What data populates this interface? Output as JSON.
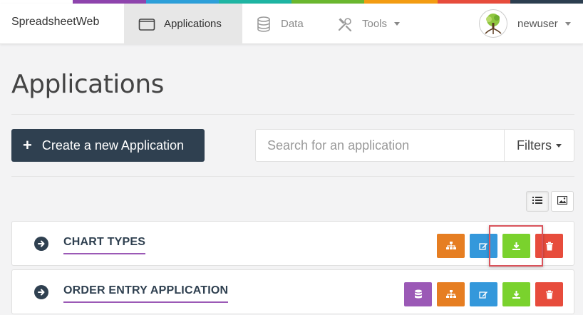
{
  "colors": {
    "strip": [
      "#ffffff",
      "#ffffff",
      "#8e44ad",
      "#3498db",
      "#1abc9c",
      "#7ac142",
      "#f39c12",
      "#e74c3c",
      "#2c3e50"
    ],
    "dark": "#2f4050",
    "purple": "#9b59b6",
    "orange": "#e67e22",
    "blue": "#3498db",
    "green": "#7ad22d",
    "red": "#e74c3c"
  },
  "navbar": {
    "brand": "SpreadsheetWeb",
    "items": [
      {
        "label": "Applications",
        "icon": "window-icon",
        "active": true
      },
      {
        "label": "Data",
        "icon": "database-icon",
        "active": false
      },
      {
        "label": "Tools",
        "icon": "tools-icon",
        "active": false
      }
    ],
    "user": {
      "name": "newuser",
      "avatar_icon": "tree-avatar-icon"
    }
  },
  "page": {
    "title": "Applications",
    "create_label": "Create a new Application",
    "search_placeholder": "Search for an application",
    "filters_label": "Filters"
  },
  "view_toggle": [
    "list-view-icon",
    "image-view-icon"
  ],
  "applications": [
    {
      "name": "CHART TYPES",
      "actions": [
        "hierarchy-icon",
        "edit-icon",
        "download-icon",
        "trash-icon"
      ]
    },
    {
      "name": "ORDER ENTRY APPLICATION",
      "actions": [
        "database-icon",
        "hierarchy-icon",
        "edit-icon",
        "download-icon",
        "trash-icon"
      ]
    }
  ]
}
